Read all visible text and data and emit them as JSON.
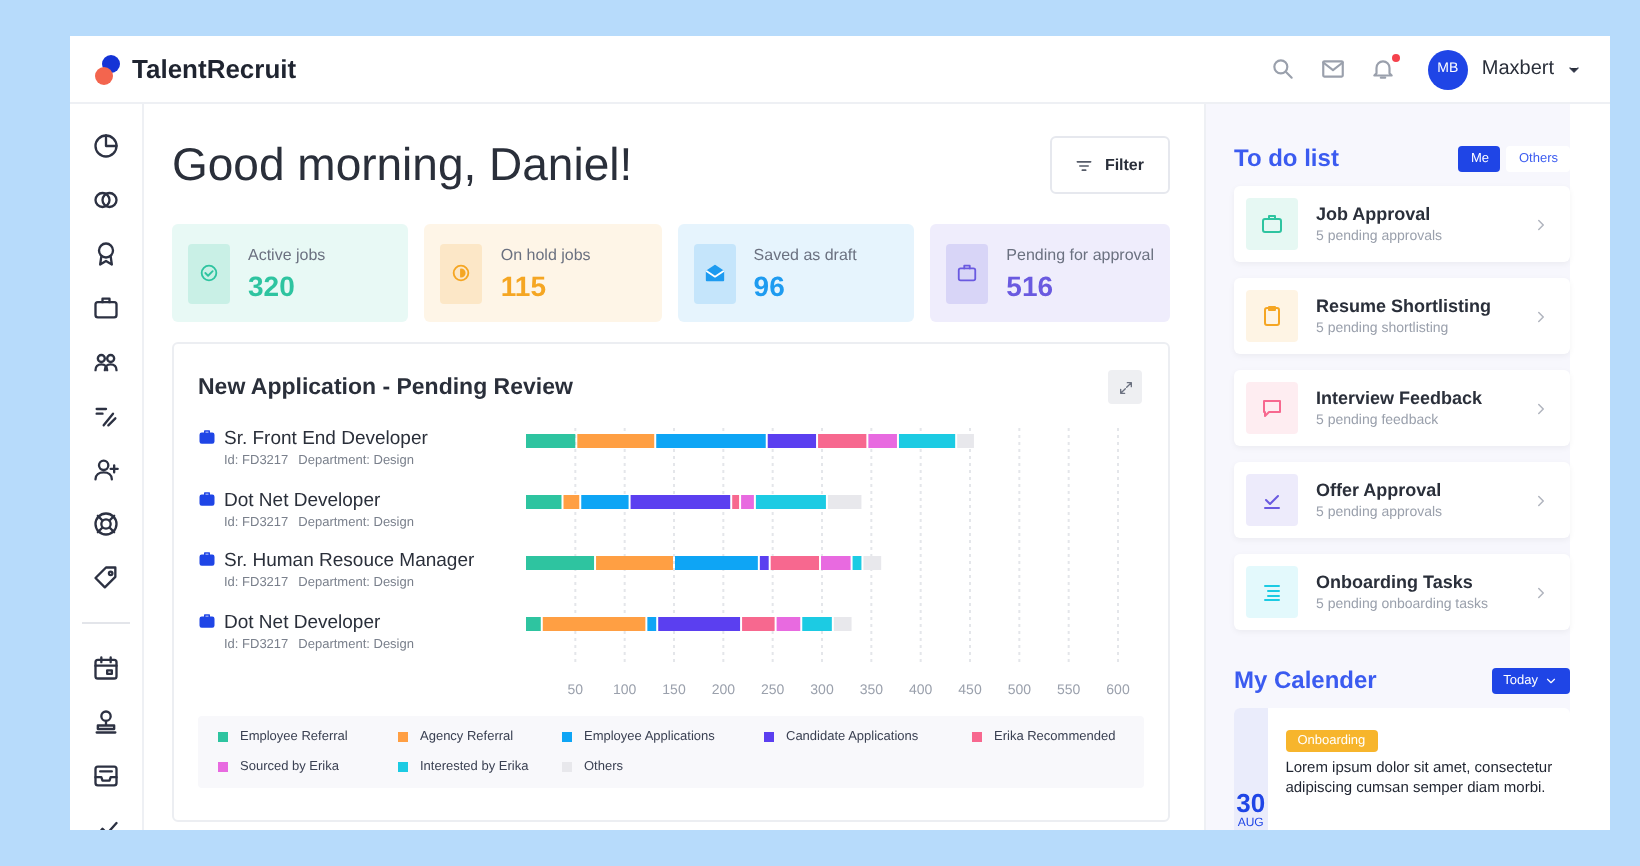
{
  "header": {
    "brand": "TalentRecruit",
    "notification_dot": true,
    "avatar_initials": "MB",
    "user_name": "Maxbert"
  },
  "greeting": "Good morning, Daniel!",
  "filter_button": "Filter",
  "stats": [
    {
      "label": "Active jobs",
      "value": "320",
      "color": "#2ec4a0"
    },
    {
      "label": "On hold jobs",
      "value": "115",
      "color": "#f5a623"
    },
    {
      "label": "Saved as draft",
      "value": "96",
      "color": "#1e9bf0"
    },
    {
      "label": "Pending for approval",
      "value": "516",
      "color": "#6a5ae0"
    }
  ],
  "chart_card": {
    "title": "New Application - Pending Review",
    "jobs": [
      {
        "id": "Id: FD3217",
        "department": "Department: Design"
      },
      {
        "id": "Id: FD3217",
        "department": "Department: Design"
      },
      {
        "id": "Id: FD3217",
        "department": "Department: Design"
      },
      {
        "id": "Id: FD3217",
        "department": "Department: Design"
      }
    ],
    "chart_data": {
      "type": "bar",
      "orientation": "horizontal",
      "stacked": true,
      "categories": [
        "Sr. Front End Developer",
        "Dot Net Developer",
        "Sr. Human Resouce Manager",
        "Dot Net Developer"
      ],
      "grid": true,
      "xlim": [
        0,
        600
      ],
      "xticks": [
        50,
        100,
        150,
        200,
        250,
        300,
        350,
        400,
        450,
        500,
        550,
        600
      ],
      "series": [
        {
          "name": "Employee Referral",
          "color": "#2ec4a0",
          "values": [
            52,
            38,
            71,
            17
          ]
        },
        {
          "name": "Agency Referral",
          "color": "#ff9f43",
          "values": [
            80,
            18,
            80,
            106
          ]
        },
        {
          "name": "Employee Applications",
          "color": "#0ea5f5",
          "values": [
            113,
            50,
            86,
            11
          ]
        },
        {
          "name": "Candidate Applications",
          "color": "#5b3ff0",
          "values": [
            51,
            103,
            11,
            85
          ]
        },
        {
          "name": "Erika Recommended",
          "color": "#f7688f",
          "values": [
            51,
            9,
            51,
            35
          ]
        },
        {
          "name": "Sourced by Erika",
          "color": "#e86ae0",
          "values": [
            31,
            15,
            32,
            26
          ]
        },
        {
          "name": "Interested by Erika",
          "color": "#1ccbe3",
          "values": [
            59,
            73,
            11,
            32
          ]
        },
        {
          "name": "Others",
          "color": "#e8e8ec",
          "values": [
            19,
            36,
            20,
            20
          ]
        }
      ]
    }
  },
  "todo": {
    "title": "To do list",
    "tabs": [
      {
        "label": "Me",
        "selected": true
      },
      {
        "label": "Others",
        "selected": false
      }
    ],
    "items": [
      {
        "title": "Job Approval",
        "subtitle": "5 pending approvals",
        "color": "#2ec4a0"
      },
      {
        "title": "Resume Shortlisting",
        "subtitle": "5 pending shortlisting",
        "color": "#f5a623"
      },
      {
        "title": "Interview Feedback",
        "subtitle": "5 pending feedback",
        "color": "#f7688f"
      },
      {
        "title": "Offer Approval",
        "subtitle": "5 pending approvals",
        "color": "#6a5ae0"
      },
      {
        "title": "Onboarding Tasks",
        "subtitle": "5 pending onboarding tasks",
        "color": "#1ccbe3"
      }
    ]
  },
  "calendar": {
    "title": "My Calender",
    "today_button": "Today",
    "event": {
      "day": "30",
      "month": "AUG",
      "tag": "Onboarding",
      "text": "Lorem ipsum dolor sit amet, consectetur adipiscing cumsan semper diam morbi."
    }
  }
}
